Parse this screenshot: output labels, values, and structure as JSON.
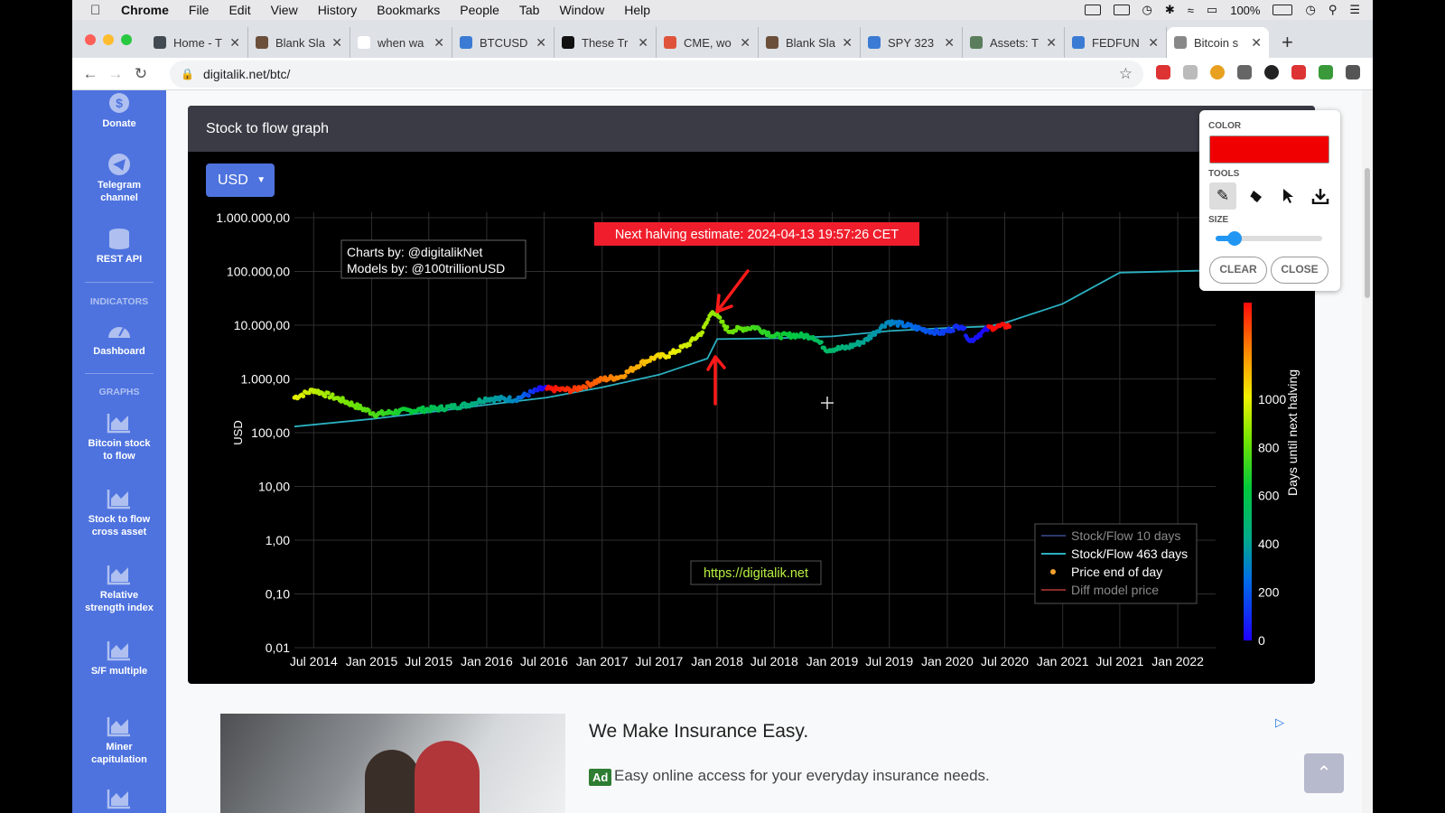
{
  "menubar": {
    "app": "Chrome",
    "items": [
      "File",
      "Edit",
      "View",
      "History",
      "Bookmarks",
      "People",
      "Tab",
      "Window",
      "Help"
    ],
    "battery": "100%"
  },
  "tabs": [
    {
      "title": "Home - T",
      "fav": "#444a52"
    },
    {
      "title": "Blank Sla",
      "fav": "#6b4f3a"
    },
    {
      "title": "when wa",
      "fav": "#ffffff"
    },
    {
      "title": "BTCUSD",
      "fav": "#3b7bd4"
    },
    {
      "title": "These Tr",
      "fav": "#111111"
    },
    {
      "title": "CME, wo",
      "fav": "#e0533b"
    },
    {
      "title": "Blank Sla",
      "fav": "#6b4f3a"
    },
    {
      "title": "SPY 323",
      "fav": "#3b7bd4"
    },
    {
      "title": "Assets: T",
      "fav": "#5b7d5b"
    },
    {
      "title": "FEDFUN",
      "fav": "#3b7bd4"
    },
    {
      "title": "Bitcoin s",
      "fav": "#888888",
      "active": true
    }
  ],
  "omnibox": {
    "url": "digitalik.net/btc/"
  },
  "sidebar": {
    "items": [
      {
        "label": "Donate",
        "name": "sidebar-item-donate",
        "icon": "dollar-icon"
      },
      {
        "label": "Telegram channel",
        "name": "sidebar-item-telegram",
        "icon": "telegram-icon"
      },
      {
        "label": "REST API",
        "name": "sidebar-item-rest-api",
        "icon": "database-icon"
      }
    ],
    "heading_indicators": "INDICATORS",
    "dashboard": {
      "label": "Dashboard",
      "icon": "gauge-icon"
    },
    "heading_graphs": "GRAPHS",
    "graphs": [
      {
        "label": "Bitcoin stock to flow",
        "name": "sidebar-item-bitcoin-stock-to-flow"
      },
      {
        "label": "Stock to flow cross asset",
        "name": "sidebar-item-s2f-cross-asset"
      },
      {
        "label": "Relative strength index",
        "name": "sidebar-item-rsi"
      },
      {
        "label": "S/F multiple",
        "name": "sidebar-item-sf-multiple"
      },
      {
        "label": "Miner capitulation",
        "name": "sidebar-item-miner-capitulation"
      }
    ]
  },
  "card": {
    "title": "Stock to flow graph",
    "currency": "USD"
  },
  "draw_tool": {
    "color_label": "COLOR",
    "color": "#f00000",
    "tools_label": "TOOLS",
    "tools": [
      "pencil-icon",
      "eraser-icon",
      "pointer-icon",
      "download-icon"
    ],
    "size_label": "SIZE",
    "size_fraction": 0.18,
    "clear": "CLEAR",
    "close": "CLOSE"
  },
  "chart_data": {
    "type": "scatter",
    "title": "",
    "ylabel": "USD",
    "yscale": "log",
    "yticks": [
      {
        "v": 1000000,
        "label": "1.000.000,00"
      },
      {
        "v": 100000,
        "label": "100.000,00"
      },
      {
        "v": 10000,
        "label": "10.000,00"
      },
      {
        "v": 1000,
        "label": "1.000,00"
      },
      {
        "v": 100,
        "label": "100,00"
      },
      {
        "v": 10,
        "label": "10,00"
      },
      {
        "v": 1,
        "label": "1,00"
      },
      {
        "v": 0.1,
        "label": "0,10"
      },
      {
        "v": 0.01,
        "label": "0,01"
      }
    ],
    "xticks": [
      "Jul 2014",
      "Jan 2015",
      "Jul 2015",
      "Jan 2016",
      "Jul 2016",
      "Jan 2017",
      "Jul 2017",
      "Jan 2018",
      "Jul 2018",
      "Jan 2019",
      "Jul 2019",
      "Jan 2020",
      "Jul 2020",
      "Jan 2021",
      "Jul 2021",
      "Jan 2022"
    ],
    "xrange": [
      "2014-05-01",
      "2022-05-01"
    ],
    "annotations": {
      "halving": "Next halving estimate: 2024-04-13 19:57:26 CET",
      "credits": [
        "Charts by: @digitalikNet",
        "Models by: @100trillionUSD"
      ],
      "site": "https://digitalik.net"
    },
    "legend": [
      {
        "name": "Stock/Flow 10 days",
        "color": "#2b3a6e",
        "kind": "line",
        "muted": true
      },
      {
        "name": "Stock/Flow 463 days",
        "color": "#2ab0c0",
        "kind": "line",
        "muted": false
      },
      {
        "name": "Price end of day",
        "color": "#f0a030",
        "kind": "dot",
        "muted": false
      },
      {
        "name": "Diff model price",
        "color": "#8b2a2a",
        "kind": "line",
        "muted": true
      }
    ],
    "legend_position": "bottom-right",
    "colorbar": {
      "title": "Days until next halving",
      "ticks": [
        0,
        200,
        400,
        600,
        800,
        1000
      ],
      "max": 1400
    },
    "series": [
      {
        "name": "Stock/Flow 463 days",
        "x": [
          "2014-05-01",
          "2015-01-01",
          "2015-07-01",
          "2016-01-01",
          "2016-07-09",
          "2017-01-01",
          "2017-07-01",
          "2017-12-01",
          "2018-01-01",
          "2018-07-01",
          "2019-01-01",
          "2019-07-01",
          "2020-01-01",
          "2020-05-11",
          "2020-07-01",
          "2021-01-01",
          "2021-07-01",
          "2022-05-01"
        ],
        "y": [
          130,
          180,
          240,
          330,
          450,
          700,
          1200,
          2400,
          5500,
          5700,
          6200,
          7800,
          8900,
          9500,
          11000,
          25000,
          95000,
          105000
        ]
      },
      {
        "name": "Price end of day",
        "x": [
          "2014-05-01",
          "2014-07-01",
          "2014-10-01",
          "2015-01-15",
          "2015-04-01",
          "2015-08-01",
          "2015-11-01",
          "2016-01-01",
          "2016-04-01",
          "2016-06-20",
          "2016-07-10",
          "2016-10-01",
          "2017-01-01",
          "2017-03-01",
          "2017-05-01",
          "2017-06-15",
          "2017-08-01",
          "2017-10-01",
          "2017-11-15",
          "2017-12-17",
          "2018-02-06",
          "2018-03-15",
          "2018-05-01",
          "2018-07-01",
          "2018-09-01",
          "2018-11-01",
          "2018-12-15",
          "2019-02-15",
          "2019-04-15",
          "2019-06-26",
          "2019-08-15",
          "2019-10-15",
          "2019-12-15",
          "2020-02-15",
          "2020-03-13",
          "2020-04-15",
          "2020-05-11",
          "2020-06-15",
          "2020-07-20"
        ],
        "y": [
          450,
          620,
          400,
          220,
          250,
          280,
          330,
          430,
          420,
          650,
          650,
          620,
          980,
          1100,
          1900,
          2500,
          2800,
          4400,
          7500,
          19000,
          7800,
          8500,
          9200,
          6300,
          6500,
          6200,
          3500,
          3800,
          5100,
          11500,
          10200,
          8300,
          7200,
          10000,
          5000,
          7000,
          8800,
          9500,
          9800
        ],
        "days": [
          1000,
          940,
          850,
          760,
          670,
          560,
          470,
          410,
          320,
          30,
          1400,
          1330,
          1240,
          1180,
          1120,
          1070,
          1020,
          960,
          920,
          880,
          830,
          800,
          740,
          680,
          620,
          560,
          520,
          460,
          400,
          330,
          270,
          210,
          150,
          90,
          60,
          30,
          1440,
          1400,
          1380
        ]
      }
    ]
  },
  "ad": {
    "title": "We Make Insurance Easy.",
    "badge": "Ad",
    "text": "Easy online access for your everyday insurance needs."
  }
}
